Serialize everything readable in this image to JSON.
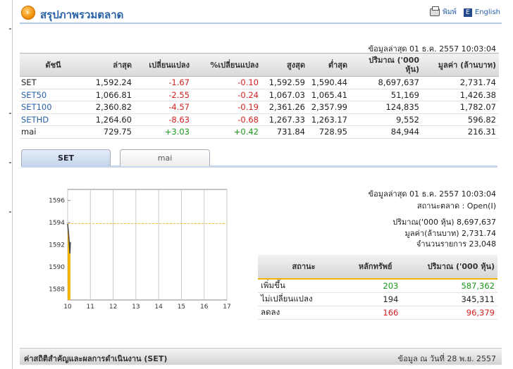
{
  "header": {
    "title": "สรุปภาพรวมตลาด",
    "print_label": "พิมพ์",
    "english_label": "English"
  },
  "market_table": {
    "timestamp": "ข้อมูลล่าสุด 01 ธ.ค. 2557 10:03:04",
    "columns": [
      "ดัชนี",
      "ล่าสุด",
      "เปลี่ยนแปลง",
      "%เปลี่ยนแปลง",
      "สูงสุด",
      "ต่ำสุด",
      "ปริมาณ ('000 หุ้น)",
      "มูลค่า (ล้านบาท)"
    ],
    "rows": [
      {
        "name": "SET",
        "last": "1,592.24",
        "change": "-1.67",
        "pct": "-0.10",
        "high": "1,592.59",
        "low": "1,590.44",
        "volume": "8,697,637",
        "value": "2,731.74",
        "dir": "neg",
        "link": false
      },
      {
        "name": "SET50",
        "last": "1,066.81",
        "change": "-2.55",
        "pct": "-0.24",
        "high": "1,067.03",
        "low": "1,065.41",
        "volume": "51,169",
        "value": "1,426.38",
        "dir": "neg",
        "link": true
      },
      {
        "name": "SET100",
        "last": "2,360.82",
        "change": "-4.57",
        "pct": "-0.19",
        "high": "2,361.26",
        "low": "2,357.99",
        "volume": "124,835",
        "value": "1,782.07",
        "dir": "neg",
        "link": true
      },
      {
        "name": "SETHD",
        "last": "1,264.60",
        "change": "-8.63",
        "pct": "-0.68",
        "high": "1,267.33",
        "low": "1,263.17",
        "volume": "9,552",
        "value": "596.82",
        "dir": "neg",
        "link": true
      },
      {
        "name": "mai",
        "last": "729.75",
        "change": "+3.03",
        "pct": "+0.42",
        "high": "731.84",
        "low": "728.95",
        "volume": "84,944",
        "value": "216.31",
        "dir": "pos",
        "link": false
      }
    ]
  },
  "tabs": [
    {
      "label": "SET",
      "active": true
    },
    {
      "label": "mai",
      "active": false
    }
  ],
  "chart_data": {
    "type": "line",
    "x_ticks": [
      "10",
      "11",
      "12",
      "13",
      "14",
      "15",
      "16",
      "17"
    ],
    "y_ticks": [
      "1596",
      "1594",
      "1592",
      "1590",
      "1588"
    ],
    "ylim": [
      1587,
      1597
    ],
    "xlim": [
      10,
      17
    ],
    "previous_close": 1593.91,
    "series": [
      {
        "x": [
          10.0,
          10.05,
          10.1,
          10.12
        ],
        "values": [
          1593.9,
          1592.8,
          1591.2,
          1592.24
        ]
      }
    ],
    "colors": {
      "area": "#f5b400",
      "line": "#444444",
      "ref": "#f0c040"
    }
  },
  "info_panel": {
    "timestamp": "ข้อมูลล่าสุด 01 ธ.ค. 2557 10:03:04",
    "status": "สถานะตลาด : Open(I)",
    "volume": "ปริมาณ('000 หุ้น) 8,697,637",
    "value": "มูลค่า(ล้านบาท) 2,731.74",
    "trades": "จำนวนรายการ 23,048"
  },
  "breadth_table": {
    "columns": [
      "สถานะ",
      "หลักทรัพย์",
      "ปริมาณ ('000 หุ้น)"
    ],
    "rows": [
      {
        "status": "เพิ่มขึ้น",
        "count": "203",
        "volume": "587,362",
        "dir": "pos"
      },
      {
        "status": "ไม่เปลี่ยนแปลง",
        "count": "194",
        "volume": "345,311",
        "dir": "none"
      },
      {
        "status": "ลดลง",
        "count": "166",
        "volume": "96,379",
        "dir": "neg"
      }
    ]
  },
  "footer": {
    "left": "ค่าสถิติสำคัญและผลการดำเนินงาน (SET)",
    "right": "ข้อมูล ณ วันที่ 28 พ.ย. 2557"
  }
}
